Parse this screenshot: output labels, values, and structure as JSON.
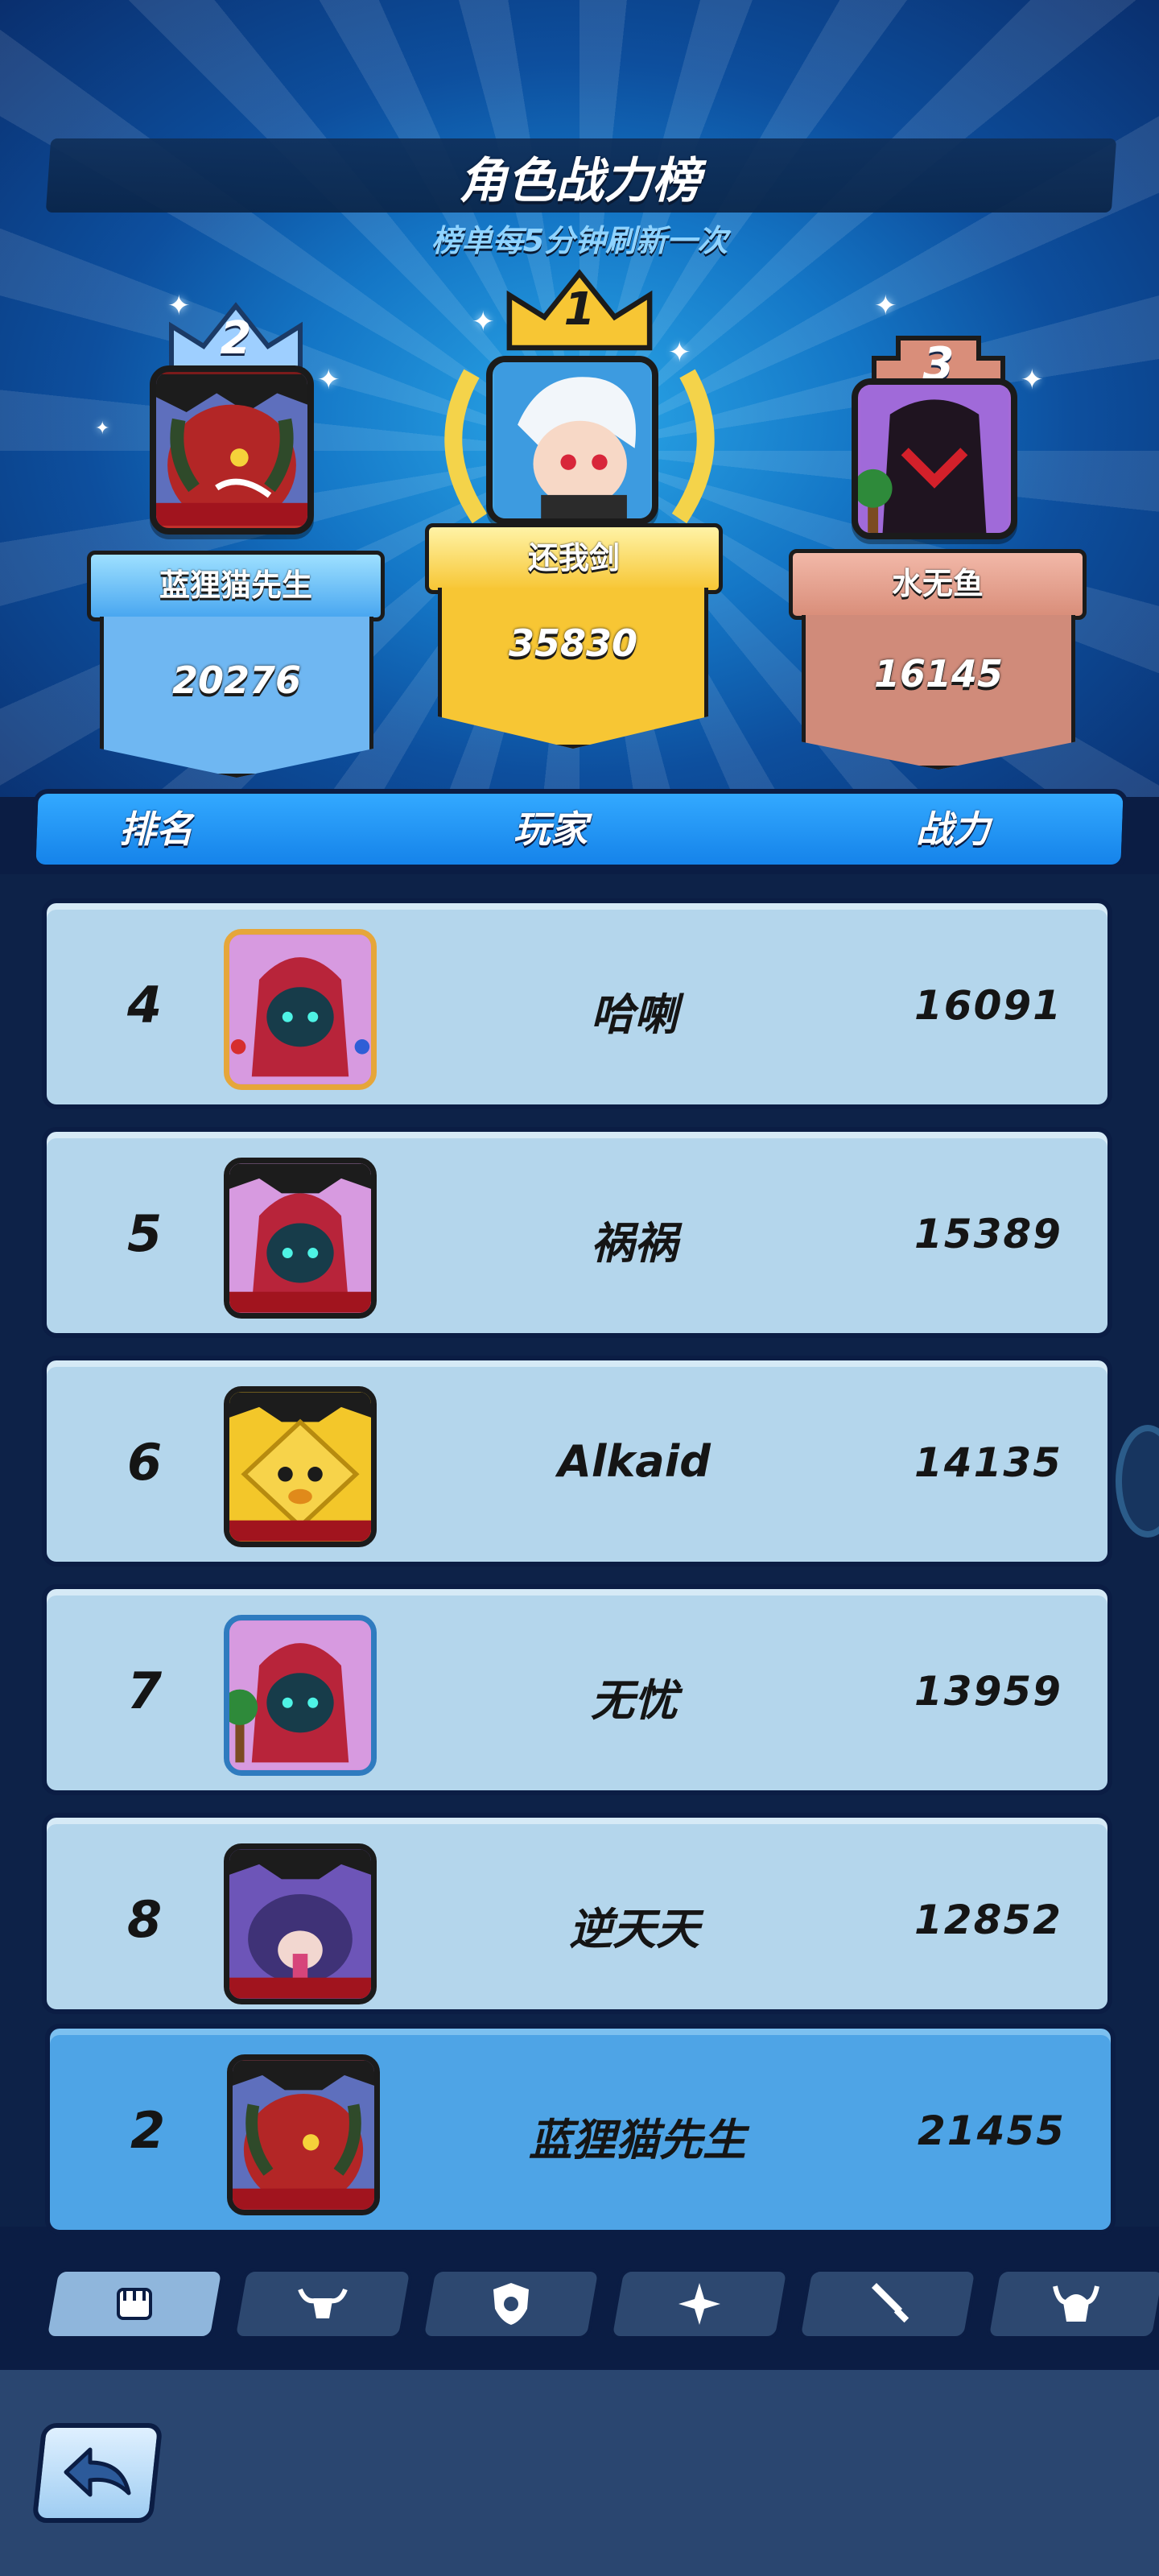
{
  "header": {
    "title": "角色战力榜",
    "subtitle": "榜单每5分钟刷新一次"
  },
  "podium": {
    "first": {
      "rank": "1",
      "name": "还我剑",
      "score": "35830"
    },
    "second": {
      "rank": "2",
      "name": "蓝狸猫先生",
      "score": "20276"
    },
    "third": {
      "rank": "3",
      "name": "水无鱼",
      "score": "16145"
    }
  },
  "table_head": {
    "rank": "排名",
    "player": "玩家",
    "power": "战力"
  },
  "rows": [
    {
      "rank": "4",
      "name": "哈喇",
      "score": "16091"
    },
    {
      "rank": "5",
      "name": "祸祸",
      "score": "15389"
    },
    {
      "rank": "6",
      "name": "Alkaid",
      "score": "14135"
    },
    {
      "rank": "7",
      "name": "无忧",
      "score": "13959"
    },
    {
      "rank": "8",
      "name": "逆天天",
      "score": "12852"
    }
  ],
  "self_row": {
    "rank": "2",
    "name": "蓝狸猫先生",
    "score": "21455"
  },
  "tabs": [
    "fist-icon",
    "bull-skull-icon",
    "shield-badge-icon",
    "shuriken-icon",
    "dagger-icon",
    "horned-helmet-icon"
  ],
  "colors": {
    "gold": "#f7c634",
    "silver": "#6fb7f2",
    "bronze": "#d98e7a",
    "self_row": "#4ea4e6",
    "row": "#b4d6ec"
  }
}
